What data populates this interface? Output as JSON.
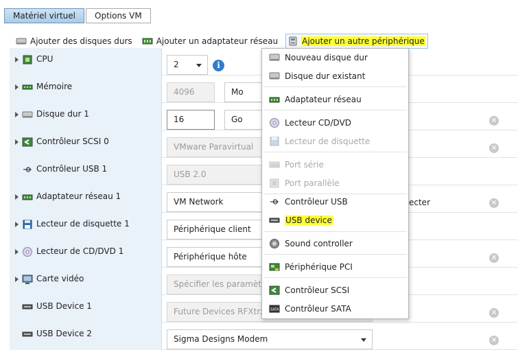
{
  "tabs": [
    {
      "label": "Matériel virtuel",
      "active": true
    },
    {
      "label": "Options VM",
      "active": false
    }
  ],
  "toolbar": {
    "add_disks": "Ajouter des disques durs",
    "add_network": "Ajouter un adaptateur réseau",
    "add_other": "Ajouter un autre périphérique"
  },
  "rows": [
    {
      "label": "CPU",
      "value": "2"
    },
    {
      "label": "Mémoire",
      "value": "4096",
      "unit": "Mo"
    },
    {
      "label": "Disque dur 1",
      "value": "16",
      "unit": "Go"
    },
    {
      "label": "Contrôleur SCSI 0",
      "value": "VMware Paravirtual"
    },
    {
      "label": "Contrôleur USB 1",
      "value": "USB 2.0"
    },
    {
      "label": "Adaptateur réseau 1",
      "value": "VM Network",
      "tail": "ecter"
    },
    {
      "label": "Lecteur de disquette 1",
      "value": "Périphérique client"
    },
    {
      "label": "Lecteur de CD/DVD 1",
      "value": "Périphérique hôte"
    },
    {
      "label": "Carte vidéo",
      "value": "Spécifier les paramètres"
    },
    {
      "label": "USB Device 1",
      "value": "Future Devices RFXtrx4"
    },
    {
      "label": "USB Device 2",
      "value": "Sigma Designs Modem"
    }
  ],
  "menu": {
    "new_disk": "Nouveau disque dur",
    "existing_disk": "Disque dur existant",
    "network_adapter": "Adaptateur réseau",
    "cd_dvd": "Lecteur CD/DVD",
    "floppy": "Lecteur de disquette",
    "serial": "Port série",
    "parallel": "Port parallèle",
    "usb_controller": "Contrôleur USB",
    "usb_device": "USB device",
    "sound": "Sound controller",
    "pci": "Périphérique PCI",
    "scsi": "Contrôleur SCSI",
    "sata": "Contrôleur SATA"
  },
  "remove_symbol": "✕",
  "info_symbol": "i",
  "colors": {
    "highlight": "#ffff33",
    "tab_active": "#b9d5ee",
    "row_label_bg": "#e9f1f9",
    "info_blue": "#2f7dc9"
  }
}
